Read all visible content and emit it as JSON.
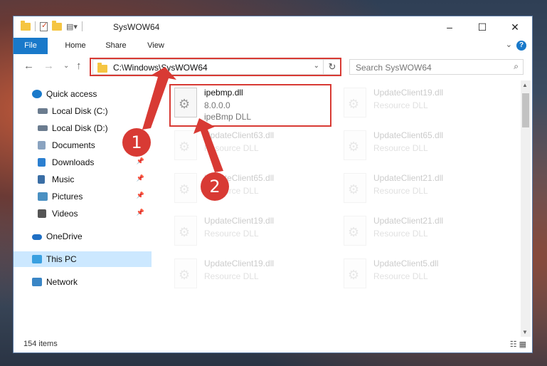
{
  "window": {
    "title": "SysWOW64",
    "minimize": "–",
    "maximize": "☐",
    "close": "✕"
  },
  "ribbon": {
    "tabs": [
      "File",
      "Home",
      "Share",
      "View"
    ],
    "help": "?",
    "expand": "⌄"
  },
  "nav": {
    "back": "←",
    "forward": "→",
    "recent": "⌄",
    "up": "↑"
  },
  "address": {
    "path": "C:\\Windows\\SysWOW64",
    "dropdown": "⌄",
    "refresh": "↻"
  },
  "search": {
    "placeholder": "Search SysWOW64",
    "icon": "⌕"
  },
  "sidebar": {
    "items": [
      {
        "label": "Quick access",
        "icon": "star-icon",
        "color": "#1979ca"
      },
      {
        "label": "Local Disk (C:)",
        "icon": "drive-icon",
        "color": "#6b7c8f"
      },
      {
        "label": "Local Disk (D:)",
        "icon": "drive-icon",
        "color": "#6b7c8f"
      },
      {
        "label": "Documents",
        "icon": "documents-icon",
        "color": "#8aa3c0"
      },
      {
        "label": "Downloads",
        "icon": "downloads-icon",
        "color": "#2b7fd0"
      },
      {
        "label": "Music",
        "icon": "music-icon",
        "color": "#3a6ea5"
      },
      {
        "label": "Pictures",
        "icon": "pictures-icon",
        "color": "#4a90c2"
      },
      {
        "label": "Videos",
        "icon": "videos-icon",
        "color": "#555"
      },
      {
        "label": "OneDrive",
        "icon": "onedrive-icon",
        "color": "#1f6fc4"
      },
      {
        "label": "This PC",
        "icon": "computer-icon",
        "color": "#3aa0e0"
      },
      {
        "label": "Network",
        "icon": "network-icon",
        "color": "#3a86c6"
      }
    ],
    "pin": "📌"
  },
  "files": [
    {
      "name": "ipebmp.dll",
      "version": "8.0.0.0",
      "desc": "ipeBmp DLL"
    },
    {
      "name": "UpdateClient19.dll",
      "desc": "Resource DLL"
    },
    {
      "name": "UpdateClient63.dll",
      "desc": "Resource DLL"
    },
    {
      "name": "UpdateClient65.dll",
      "desc": "Resource DLL"
    },
    {
      "name": "UpdateClient65.dll",
      "desc": "Resource DLL"
    },
    {
      "name": "UpdateClient21.dll",
      "desc": "Resource DLL"
    },
    {
      "name": "UpdateClient19.dll",
      "desc": "Resource DLL"
    },
    {
      "name": "UpdateClient21.dll",
      "desc": "Resource DLL"
    },
    {
      "name": "UpdateClient19.dll",
      "desc": "Resource DLL"
    },
    {
      "name": "UpdateClient5.dll",
      "desc": "Resource DLL"
    }
  ],
  "status": {
    "count": "154 items",
    "views": "☷ ▦"
  },
  "annotations": {
    "step1": "1",
    "step2": "2",
    "accent": "#d83a34"
  }
}
